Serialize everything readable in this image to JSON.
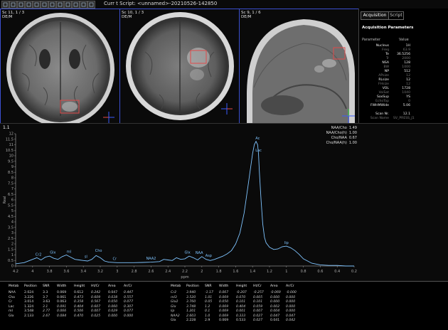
{
  "titlebar": {
    "title": "Curr   t Script: <unnamed>-20210526-142850"
  },
  "toolbar": {
    "icons": [
      "cursor-icon",
      "zoom-icon",
      "hand-icon",
      "window-level-icon",
      "measure-icon",
      "grid-icon",
      "roi-icon",
      "layout-icon",
      "settings-icon",
      "help-icon",
      "close-icon",
      "script-icon"
    ]
  },
  "viewports": [
    {
      "label": "Sc 11, 1 / 3\nDE/M"
    },
    {
      "label": "Sc 10, 1 / 3\nDE/M"
    },
    {
      "label": "Sc 9, 1 / 6\nDE/M"
    }
  ],
  "orientation": {
    "left": "R",
    "right": "L",
    "top": "A",
    "bottom": "P",
    "top2": "H",
    "bottom2": "F"
  },
  "side": {
    "tabs": [
      "Acquisition",
      "Script"
    ],
    "title": "Acquisition Parameters",
    "col_param": "Parameter",
    "col_value": "Value",
    "rows": [
      {
        "name": "Nucleus",
        "value": "1H",
        "dim": false
      },
      {
        "name": "Freq",
        "value": "63.9",
        "dim": true
      },
      {
        "name": "Te",
        "value": "36.5256",
        "dim": false
      },
      {
        "name": "Tr",
        "value": "2000",
        "dim": true
      },
      {
        "name": "NSA",
        "value": "128",
        "dim": false
      },
      {
        "name": "BW",
        "value": "1000",
        "dim": true
      },
      {
        "name": "NP",
        "value": "512",
        "dim": false
      },
      {
        "name": "APsize",
        "value": "12",
        "dim": true
      },
      {
        "name": "RLsize",
        "value": "12",
        "dim": false
      },
      {
        "name": "FHsize",
        "value": "12",
        "dim": true
      },
      {
        "name": "VOL",
        "value": "1728",
        "dim": false
      },
      {
        "name": "VoiSat",
        "value": "1040",
        "dim": true
      },
      {
        "name": "SoxSup",
        "value": "YS",
        "dim": false
      },
      {
        "name": "EchoTop",
        "value": "0",
        "dim": true
      },
      {
        "name": "FWHMWide",
        "value": "5.06",
        "dim": false
      },
      {
        "name": "",
        "value": "",
        "dim": false
      },
      {
        "name": "Scan Nr.",
        "value": "12.1",
        "dim": false
      },
      {
        "name": "Scan Name",
        "value": "SV_PRESS_J1",
        "dim": true
      }
    ]
  },
  "spectrum": {
    "tag": "1.1",
    "ratios": [
      {
        "label": "NAA/Cho",
        "value": "1.49"
      },
      {
        "label": "NAA/Cho(h)",
        "value": "1.00"
      },
      {
        "label": "Cho/NAA",
        "value": "0.67"
      },
      {
        "label": "Cho/NAA(h)",
        "value": "1.00"
      }
    ],
    "xlabel": "ppm",
    "ylabel": "Real"
  },
  "chart_data": {
    "type": "line",
    "xlim": [
      4.2,
      0.2
    ],
    "ylim": [
      0,
      12
    ],
    "x_ticks": [
      4.2,
      4,
      3.8,
      3.6,
      3.4,
      3.2,
      3,
      2.8,
      2.6,
      2.4,
      2.2,
      2,
      1.8,
      1.6,
      1.4,
      1.2,
      1,
      0.8,
      0.6,
      0.4,
      0.2
    ],
    "x_tick_labels": [
      "4.2",
      "4",
      "3.8",
      "3.6",
      "3.4",
      "3.2",
      "3",
      "2.8",
      "2.6",
      "2.4",
      "2.2",
      "2",
      "1.8",
      "1.6",
      "1.4",
      "1.2",
      "1",
      "0.8",
      "0.6",
      "0.4",
      "0.2"
    ],
    "y_ticks": [
      0,
      0.5,
      1,
      1.5,
      2,
      2.5,
      3,
      3.5,
      4,
      4.5,
      5,
      5.5,
      6,
      6.5,
      7,
      7.5,
      8,
      8.5,
      9,
      9.5,
      10,
      10.5,
      11,
      11.5,
      12
    ],
    "y_tick_labels": [
      "0",
      "0.5",
      "1",
      "1.5",
      "2",
      "2.5",
      "3",
      "3.5",
      "4",
      "4.5",
      "5",
      "5.5",
      "6",
      "6.5",
      "7",
      "7.5",
      "8",
      "8.5",
      "9",
      "9.5",
      "10",
      "10.5",
      "11",
      "11.5",
      "12"
    ],
    "x": [
      4.2,
      4.1,
      4.0,
      3.95,
      3.9,
      3.85,
      3.8,
      3.75,
      3.7,
      3.65,
      3.6,
      3.55,
      3.5,
      3.45,
      3.4,
      3.35,
      3.3,
      3.25,
      3.2,
      3.15,
      3.1,
      3.0,
      2.9,
      2.8,
      2.7,
      2.6,
      2.5,
      2.45,
      2.4,
      2.35,
      2.3,
      2.25,
      2.2,
      2.15,
      2.1,
      2.05,
      2.0,
      1.95,
      1.9,
      1.85,
      1.8,
      1.75,
      1.7,
      1.65,
      1.6,
      1.55,
      1.5,
      1.45,
      1.4,
      1.38,
      1.36,
      1.34,
      1.33,
      1.32,
      1.3,
      1.28,
      1.26,
      1.24,
      1.2,
      1.15,
      1.1,
      1.05,
      1.0,
      0.95,
      0.9,
      0.85,
      0.8,
      0.7,
      0.6,
      0.5,
      0.4,
      0.3,
      0.2
    ],
    "y": [
      0.2,
      0.3,
      0.6,
      0.75,
      0.55,
      0.8,
      0.9,
      0.7,
      0.6,
      0.85,
      1.0,
      0.8,
      0.6,
      0.55,
      0.5,
      0.45,
      0.6,
      0.95,
      0.75,
      0.45,
      0.35,
      0.3,
      0.3,
      0.3,
      0.32,
      0.35,
      0.4,
      0.6,
      0.55,
      0.5,
      0.75,
      0.6,
      0.65,
      0.9,
      0.75,
      0.55,
      0.85,
      0.6,
      0.5,
      0.6,
      0.75,
      0.9,
      1.1,
      1.4,
      2.0,
      3.0,
      4.8,
      7.5,
      10.2,
      11.0,
      11.3,
      11.0,
      10.2,
      8.6,
      6.0,
      3.8,
      2.6,
      2.1,
      1.7,
      1.5,
      1.55,
      1.75,
      1.8,
      1.65,
      1.4,
      1.05,
      0.65,
      0.25,
      0.1,
      0.05,
      0.05,
      0.0,
      0.0
    ],
    "peaks": [
      {
        "label": "Cr2",
        "x": 3.93,
        "y": 0.75
      },
      {
        "label": "Glx",
        "x": 3.76,
        "y": 0.95
      },
      {
        "label": "mI",
        "x": 3.57,
        "y": 1.0
      },
      {
        "label": "sI",
        "x": 3.37,
        "y": 0.55
      },
      {
        "label": "Cho",
        "x": 3.22,
        "y": 1.1
      },
      {
        "label": "Cr",
        "x": 3.03,
        "y": 0.35
      },
      {
        "label": "NAA2",
        "x": 2.6,
        "y": 0.4
      },
      {
        "label": "Glx",
        "x": 2.17,
        "y": 0.95
      },
      {
        "label": "NAA",
        "x": 2.03,
        "y": 0.9
      },
      {
        "label": "Asp",
        "x": 1.92,
        "y": 0.65
      },
      {
        "label": "Ac",
        "x": 1.34,
        "y": 11.3
      },
      {
        "label": "Lac",
        "x": 1.33,
        "y": 10.2
      },
      {
        "label": "lip",
        "x": 1.0,
        "y": 1.8
      }
    ]
  },
  "metab_table": {
    "headers": [
      "Metab",
      "Position",
      "SNR",
      "Width",
      "Height",
      "Ht/Cr",
      "Area",
      "Ar/Cr"
    ],
    "left_rows": [
      {
        "cells": [
          "NAA",
          "2.024",
          "3.3",
          "0.069",
          "0.612",
          "0.242",
          "0.047",
          "0.447"
        ],
        "italic": [
          false,
          false,
          false,
          false,
          false,
          true,
          false,
          true
        ]
      },
      {
        "cells": [
          "Cho",
          "3.226",
          "3.7",
          "0.061",
          "0.473",
          "0.609",
          "0.038",
          "0.557"
        ],
        "italic": [
          false,
          false,
          false,
          false,
          true,
          true,
          true,
          true
        ]
      },
      {
        "cells": [
          "Cr",
          "3.014",
          "3.63",
          "0.063",
          "0.358",
          "0.567",
          "0.050",
          "0.077"
        ],
        "italic": [
          false,
          false,
          false,
          false,
          true,
          true,
          true,
          true
        ]
      },
      {
        "cells": [
          "Lac",
          "1.324",
          "3.1",
          "0.091",
          "0.404",
          "0.607",
          "0.060",
          "0.307"
        ],
        "italic": [
          false,
          false,
          true,
          true,
          true,
          true,
          true,
          true
        ]
      },
      {
        "cells": [
          "mI",
          "3.548",
          "2.77",
          "0.066",
          "0.506",
          "0.007",
          "0.029",
          "0.077"
        ],
        "italic": [
          false,
          false,
          true,
          true,
          true,
          true,
          true,
          true
        ]
      },
      {
        "cells": [
          "Glx",
          "2.133",
          "2.67",
          "0.084",
          "0.470",
          "0.025",
          "0.000",
          "0.000"
        ],
        "italic": [
          false,
          false,
          true,
          true,
          true,
          true,
          true,
          true
        ]
      }
    ],
    "right_rows": [
      {
        "cells": [
          "Cr2",
          "3.940",
          "-1.17",
          "0.067",
          "-0.207",
          "-0.257",
          "-0.069",
          "-0.000"
        ],
        "italic": [
          true,
          true,
          true,
          true,
          true,
          true,
          true,
          true
        ]
      },
      {
        "cells": [
          "mI3",
          "3.520",
          "1.01",
          "0.069",
          "0.070",
          "0.005",
          "0.000",
          "0.000"
        ],
        "italic": [
          true,
          true,
          true,
          true,
          true,
          true,
          true,
          true
        ]
      },
      {
        "cells": [
          "Glx2",
          "3.760",
          "0.05",
          "0.050",
          "0.101",
          "0.101",
          "0.000",
          "0.000"
        ],
        "italic": [
          true,
          true,
          true,
          true,
          true,
          true,
          true,
          true
        ]
      },
      {
        "cells": [
          "Glx",
          "3.748",
          "1.2",
          "0.069",
          "0.404",
          "0.059",
          "0.002",
          "0.000"
        ],
        "italic": [
          true,
          true,
          true,
          true,
          true,
          true,
          true,
          true
        ]
      },
      {
        "cells": [
          "lip",
          "1.201",
          "0.1",
          "0.069",
          "0.001",
          "0.007",
          "0.004",
          "0.000"
        ],
        "italic": [
          true,
          true,
          true,
          true,
          true,
          true,
          true,
          true
        ]
      },
      {
        "cells": [
          "NAA2",
          "2.603",
          "1.0",
          "0.069",
          "0.333",
          "0.027",
          "0.047",
          "0.047"
        ],
        "italic": [
          true,
          true,
          true,
          true,
          true,
          true,
          true,
          true
        ]
      },
      {
        "cells": [
          "Glx",
          "2.228",
          "2.9",
          "0.069",
          "0.533",
          "0.027",
          "0.041",
          "0.042"
        ],
        "italic": [
          false,
          false,
          false,
          false,
          false,
          true,
          false,
          true
        ]
      }
    ]
  },
  "colors": {
    "spectrum": "#7fc4ff",
    "viewport_border": "#3b50d0",
    "roi": "#e04a4a",
    "peak_label": "#7fc4ff"
  }
}
